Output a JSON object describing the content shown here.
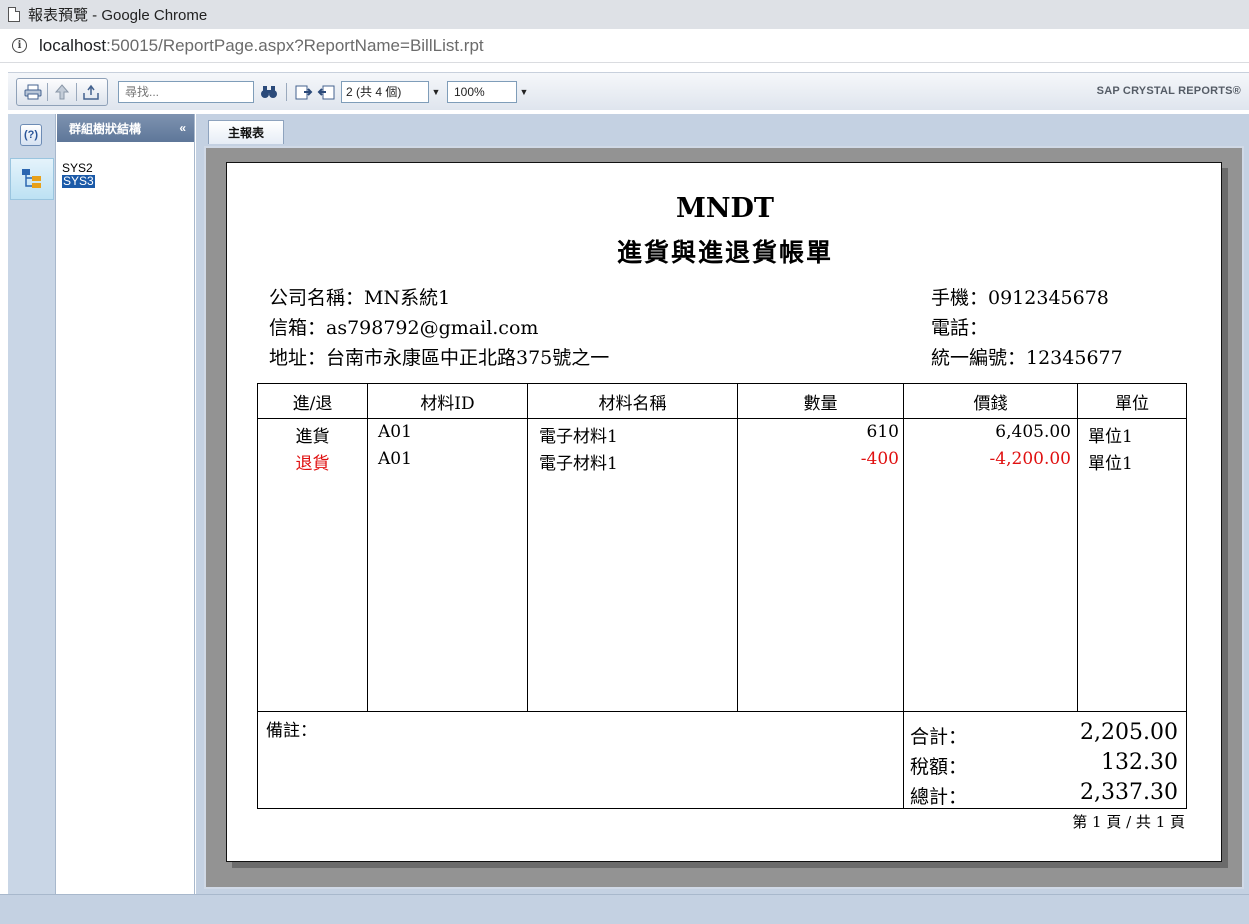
{
  "browser": {
    "window_title": "報表預覽 - Google Chrome",
    "url_host": "localhost",
    "url_rest": ":50015/ReportPage.aspx?ReportName=BillList.rpt"
  },
  "toolbar": {
    "search_placeholder": "尋找...",
    "page_select": "2 (共 4 個)",
    "zoom": "100%",
    "brand": "SAP CRYSTAL REPORTS®"
  },
  "group_tree": {
    "title": "群組樹狀結構",
    "collapse_glyph": "«",
    "items": [
      "SYS2",
      "SYS3"
    ],
    "selected": "SYS3"
  },
  "tabs": [
    {
      "label": "主報表"
    }
  ],
  "report": {
    "company": "MNDT",
    "title": "進貨與進退貨帳單",
    "company_name": "公司名稱：MN系統1",
    "email": "信箱：as798792@gmail.com",
    "address": "地址：台南市永康區中正北路375號之一",
    "mobile": "手機：0912345678",
    "phone": "電話：",
    "tax_id": "統一編號：12345677",
    "columns": [
      "進/退",
      "材料ID",
      "材料名稱",
      "數量",
      "價錢",
      "單位"
    ],
    "rows": [
      {
        "type": "進貨",
        "material_id": "A01",
        "material_name": "電子材料1",
        "qty": "610",
        "price": "6,405.00",
        "unit": "單位1",
        "return": false
      },
      {
        "type": "退貨",
        "material_id": "A01",
        "material_name": "電子材料1",
        "qty": "-400",
        "price": "-4,200.00",
        "unit": "單位1",
        "return": true
      }
    ],
    "remark_label": "備註：",
    "subtotal_label": "合計：",
    "subtotal": "2,205.00",
    "tax_label": "稅額：",
    "tax": "132.30",
    "total_label": "總計：",
    "total": "2,337.30",
    "page_info": "第 1 頁 / 共 1 頁"
  },
  "colors": {
    "return_text": "#e01010",
    "viewer_bg": "#939393",
    "panel_bg": "#c4d1e2"
  }
}
